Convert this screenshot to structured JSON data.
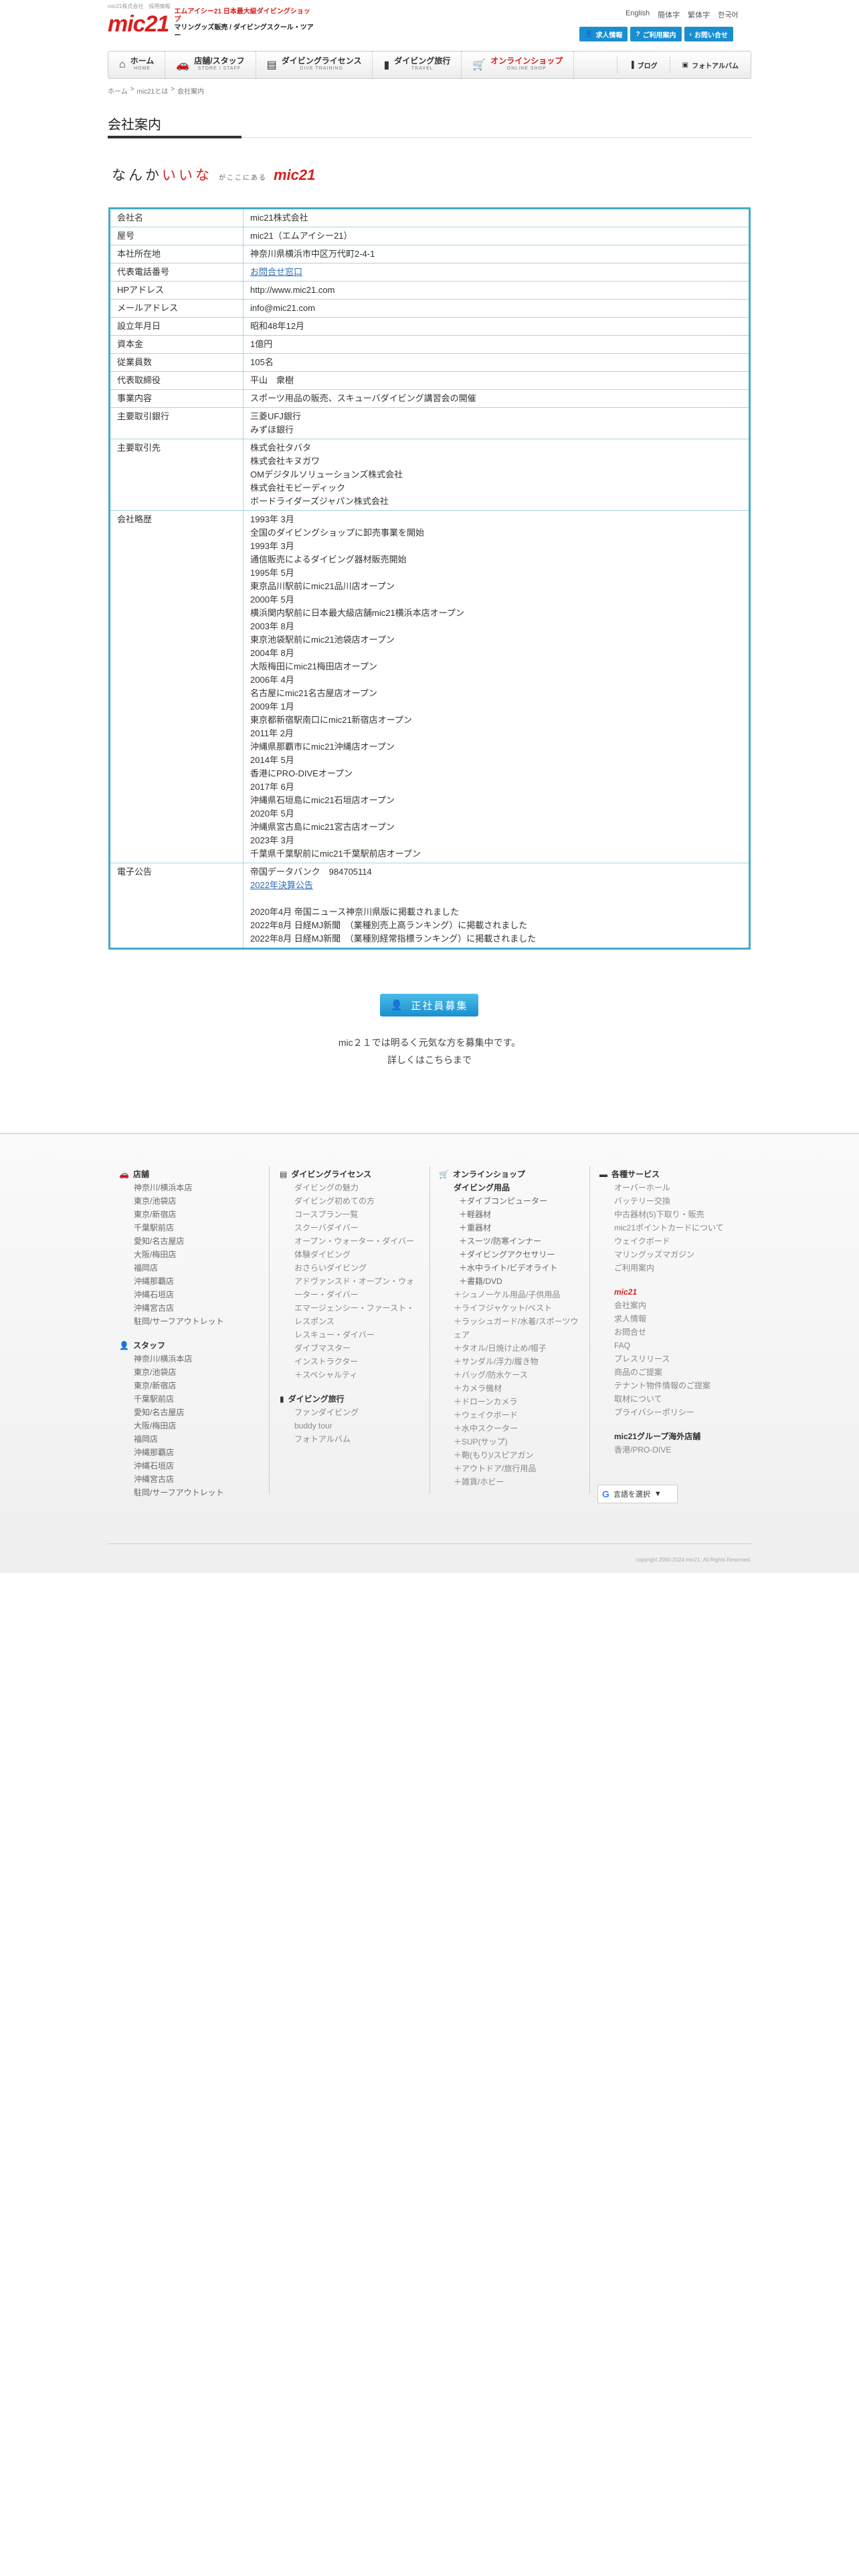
{
  "header": {
    "topline": "mic21株式会社　採用情報",
    "logo": "mic21",
    "logo_tagline1": "エムアイシー21 日本最大級ダイビングショップ",
    "logo_tagline2": "マリングッズ販売 / ダイビングスクール・ツアー",
    "lang": [
      "English",
      "簡体字",
      "繁体字",
      "한국어"
    ],
    "quick": [
      "求人情報",
      "ご利用案内",
      "お問い合せ"
    ]
  },
  "nav": {
    "items": [
      {
        "jp": "ホーム",
        "en": "HOME",
        "icon": "home-icon"
      },
      {
        "jp": "店舗/スタッフ",
        "en": "STORE / STAFF",
        "icon": "car-icon"
      },
      {
        "jp": "ダイビングライセンス",
        "en": "DIVE TRAINING",
        "icon": "book-icon"
      },
      {
        "jp": "ダイビング旅行",
        "en": "TRAVEL",
        "icon": "tank-icon"
      },
      {
        "jp": "オンラインショップ",
        "en": "ONLINE SHOP",
        "icon": "cart-icon"
      }
    ],
    "blog": "ブログ",
    "album": "フォトアルバム"
  },
  "breadcrumb": [
    "ホーム",
    ">",
    "mic21とは",
    ">",
    "会社案内"
  ],
  "page_title": "会社案内",
  "catch": {
    "part1": "なんか",
    "part2": "いいな",
    "part3": "がここにある",
    "brand": "mic21"
  },
  "company": [
    {
      "k": "会社名",
      "v": [
        "mic21株式会社"
      ]
    },
    {
      "k": "屋号",
      "v": [
        "mic21（エムアイシー21）"
      ]
    },
    {
      "k": "本社所在地",
      "v": [
        "神奈川県横浜市中区万代町2-4-1"
      ]
    },
    {
      "k": "代表電話番号",
      "v": [
        "お問合せ窓口"
      ],
      "link": true
    },
    {
      "k": "HPアドレス",
      "v": [
        "http://www.mic21.com"
      ]
    },
    {
      "k": "メールアドレス",
      "v": [
        "info@mic21.com"
      ]
    },
    {
      "k": "設立年月日",
      "v": [
        "昭和48年12月"
      ]
    },
    {
      "k": "資本金",
      "v": [
        "1億円"
      ]
    },
    {
      "k": "従業員数",
      "v": [
        "105名"
      ]
    },
    {
      "k": "代表取締役",
      "v": [
        "平山　衆樹"
      ]
    },
    {
      "k": "事業内容",
      "v": [
        "スポーツ用品の販売、スキューバダイビング講習会の開催"
      ]
    },
    {
      "k": "主要取引銀行",
      "v": [
        "三菱UFJ銀行",
        "みずほ銀行"
      ]
    },
    {
      "k": "主要取引先",
      "v": [
        "株式会社タバタ",
        "株式会社キヌガワ",
        "OMデジタルソリューションズ株式会社",
        "株式会社モビーディック",
        "ボードライダーズジャパン株式会社"
      ]
    },
    {
      "k": "会社略歴",
      "v": [
        "1993年 3月",
        "全国のダイビングショップに卸売事業を開始",
        "1993年 3月",
        "通信販売によるダイビング器材販売開始",
        "1995年 5月",
        "東京品川駅前にmic21品川店オープン",
        "2000年 5月",
        "横浜関内駅前に日本最大級店舗mic21横浜本店オープン",
        "2003年 8月",
        "東京池袋駅前にmic21池袋店オープン",
        "2004年 8月",
        "大阪梅田にmic21梅田店オープン",
        "2006年 4月",
        "名古屋にmic21名古屋店オープン",
        "2009年 1月",
        "東京都新宿駅南口にmic21新宿店オープン",
        "2011年 2月",
        "沖縄県那覇市にmic21沖縄店オープン",
        "2014年 5月",
        "香港にPRO-DIVEオープン",
        "2017年 6月",
        "沖縄県石垣島にmic21石垣店オープン",
        "2020年 5月",
        "沖縄県宮古島にmic21宮古店オープン",
        "2023年 3月",
        "千葉県千葉駅前にmic21千葉駅前店オープン"
      ]
    },
    {
      "k": "電子公告",
      "v": [
        "帝国データバンク　984705114",
        "2022年決算公告",
        "",
        "2020年4月 帝国ニュース神奈川県版に掲載されました",
        "2022年8月 日経MJ新聞　（業種別売上高ランキング）に掲載されました",
        "2022年8月 日経MJ新聞　（業種別経常指標ランキング）に掲載されました"
      ]
    }
  ],
  "recruit": {
    "button": "正社員募集",
    "line1": "mic２１では明るく元気な方を募集中です。",
    "line2": "詳しくはこちらまで"
  },
  "footer": {
    "col1": {
      "stores_title": "店舗",
      "stores": [
        "神奈川/横浜本店",
        "東京/池袋店",
        "東京/新宿店",
        "千葉駅前店",
        "愛知/名古屋店",
        "大阪/梅田店",
        "福岡店",
        "沖縄那覇店",
        "沖縄石垣店",
        "沖縄宮古店",
        "駐岡/サーフアウトレット"
      ],
      "staff_title": "スタッフ",
      "staff": [
        "神奈川/横浜本店",
        "東京/池袋店",
        "東京/新宿店",
        "千葉駅前店",
        "愛知/名古屋店",
        "大阪/梅田店",
        "福岡店",
        "沖縄那覇店",
        "沖縄石垣店",
        "沖縄宮古店",
        "駐岡/サーフアウトレット"
      ]
    },
    "col2": {
      "license_title": "ダイビングライセンス",
      "license": [
        "ダイビングの魅力",
        "ダイビング初めての方",
        "コースプラン一覧",
        "スクーバダイバー",
        "オープン・ウォーター・ダイバー",
        "体験ダイビング",
        "おさらいダイビング",
        "アドヴァンスド・オープン・ウォーター・ダイバー",
        "エマージェンシー・ファースト・レスポンス",
        "レスキュー・ダイバー",
        "ダイブマスター",
        "インストラクター",
        "＋スペシャルティ"
      ],
      "travel_title": "ダイビング旅行",
      "travel": [
        "ファンダイビング",
        "buddy tour",
        "フォトアルバム"
      ]
    },
    "col3": {
      "shop_title": "オンラインショップ",
      "sub": "ダイビング用品",
      "items": [
        "＋ダイブコンピューター",
        "＋軽器材",
        "＋重器材",
        "＋スーツ/防寒インナー",
        "＋ダイビングアクセサリー",
        "＋水中ライト/ビデオライト",
        "＋書籍/DVD"
      ],
      "items2": [
        "＋シュノーケル用品/子供用品",
        "＋ライフジャケット/ベスト",
        "＋ラッシュガード/水着/スポーツウェア",
        "＋タオル/日焼け止め/帽子",
        "＋サンダル/浮力/履き物",
        "＋バッグ/防水ケース",
        "＋カメラ機材",
        "＋ドローンカメラ",
        "＋ウェイクボード",
        "＋水中スクーター",
        "＋SUP(サップ)",
        "＋鞄(もり)/スピアガン",
        "＋アウトドア/旅行用品",
        "＋雑貨/ホビー"
      ]
    },
    "col4": {
      "service_title": "各種サービス",
      "service": [
        "オーバーホール",
        "バッテリー交換",
        "中古器材(5)下取り・販売",
        "mic21ポイントカードについて",
        "ウェイクボード",
        "マリングッズマガジン",
        "ご利用案内"
      ],
      "mic_title": "mic21",
      "mic": [
        "会社案内",
        "求人情報",
        "お問合せ",
        "FAQ",
        "プレスリリース",
        "商品のご提案",
        "テナント物件情報のご提案",
        "取材について",
        "プライバシーポリシー"
      ],
      "group_title": "mic21グループ海外店舗",
      "group": [
        "香港/PRO-DIVE"
      ],
      "translate": "言語を選択"
    },
    "copyright": "copyright 2000-2024 mic21. All Rights Reserved."
  },
  "colors": {
    "brand_red": "#d8201f",
    "accent_blue": "#1a8fd0",
    "table_border": "#44a9c6"
  }
}
